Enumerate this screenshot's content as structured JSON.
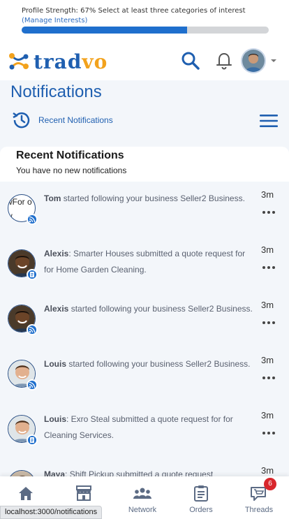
{
  "profile": {
    "text": "Profile Strength: 67% Select at least three categories of interest",
    "manage_link": "(Manage Interests)",
    "progress_fraction": 0.67
  },
  "header": {
    "logo_part1": "trad",
    "logo_part2": "vo"
  },
  "page": {
    "title": "Notifications",
    "recent_label": "Recent Notifications"
  },
  "recent_card": {
    "title": "Recent Notifications",
    "subtitle": "You have no new notifications"
  },
  "notifications": [
    {
      "name": "Tom",
      "message": " started following your business Seller2 Business.",
      "time": "3m",
      "badge_icon": "rss-icon",
      "avatar_text": "wFor ow"
    },
    {
      "name": "Alexis",
      "message": ": Smarter Houses submitted a quote request for for Home Garden Cleaning.",
      "time": "3m",
      "badge_icon": "document-icon"
    },
    {
      "name": "Alexis",
      "message": " started following your business Seller2 Business.",
      "time": "3m",
      "badge_icon": "rss-icon"
    },
    {
      "name": "Louis",
      "message": " started following your business Seller2 Business.",
      "time": "3m",
      "badge_icon": "rss-icon"
    },
    {
      "name": "Louis",
      "message": ": Exro Steal submitted a quote request for for Cleaning Services.",
      "time": "3m",
      "badge_icon": "document-icon"
    },
    {
      "name": "Maya",
      "message": ": Shift Pickup submitted a quote request",
      "time": "3m",
      "badge_icon": "document-icon"
    }
  ],
  "bottom_nav": {
    "items": [
      {
        "label": "",
        "icon": "home-icon"
      },
      {
        "label": "",
        "icon": "store-icon"
      },
      {
        "label": "Network",
        "icon": "network-icon"
      },
      {
        "label": "Orders",
        "icon": "clipboard-icon"
      },
      {
        "label": "Threads",
        "icon": "cart-icon",
        "badge": "6"
      }
    ]
  },
  "status_url": "localhost:3000/notifications",
  "colors": {
    "brand_blue": "#1f5fb0",
    "brand_orange": "#f2a21d",
    "progress": "#1f6fcd",
    "badge_red": "#d8262c"
  }
}
